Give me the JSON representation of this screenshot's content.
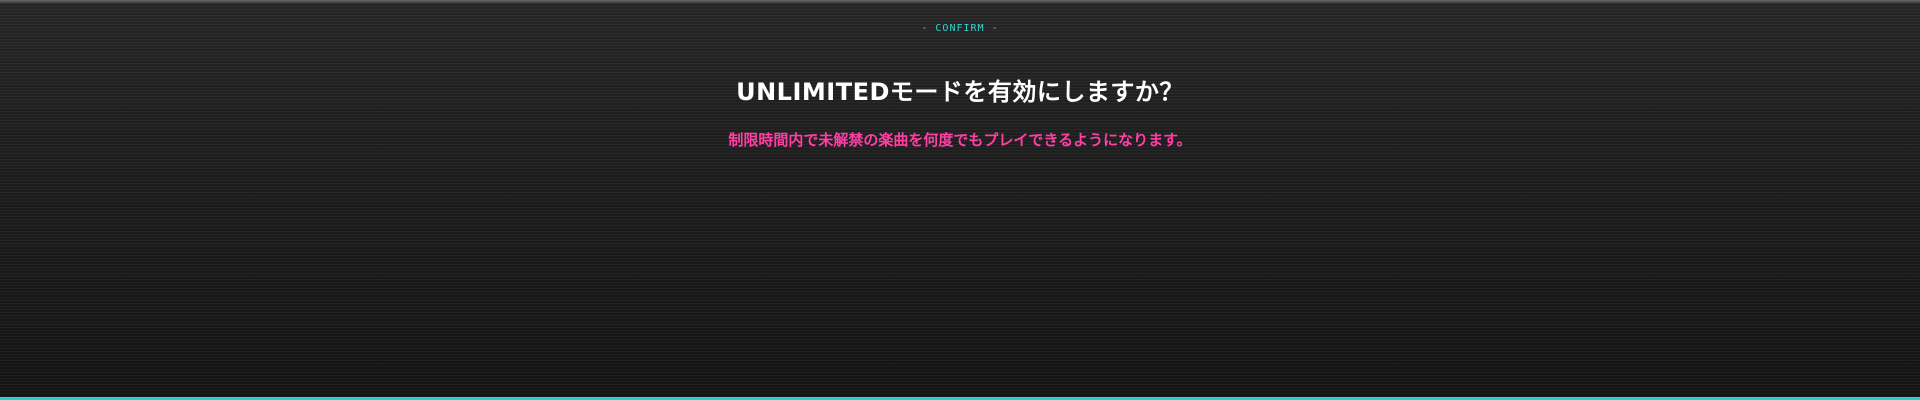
{
  "dialog": {
    "header_label": "- CONFIRM -",
    "title": "UNLIMITEDモードを有効にしますか？",
    "message": "制限時間内で未解禁の楽曲を何度でもプレイできるようになります。"
  },
  "colors": {
    "header_label": "#2fd6d0",
    "title": "#ffffff",
    "message": "#ff3fa4",
    "bottom_accent": "#22d3cc"
  }
}
